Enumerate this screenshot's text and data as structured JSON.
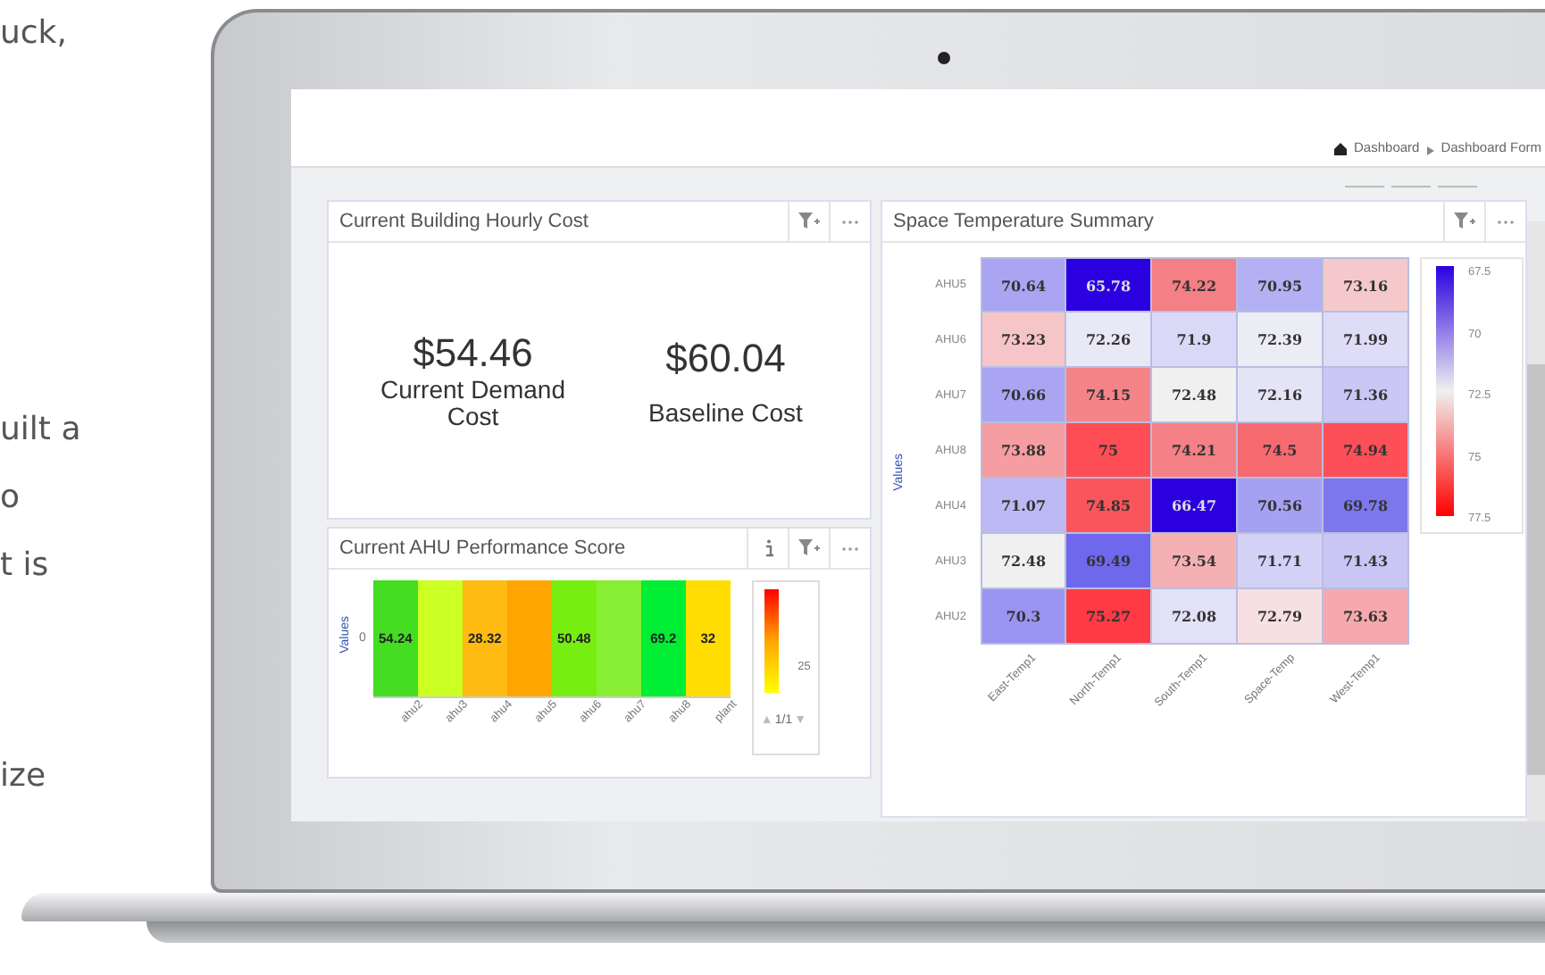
{
  "intro_text": [
    "uck,",
    "uilt a",
    "o",
    "t is",
    "ize"
  ],
  "breadcrumb": [
    "Dashboard",
    "Dashboard Form"
  ],
  "cost_panel": {
    "title": "Current Building Hourly Cost",
    "kpis": [
      {
        "value": "$54.46",
        "label": "Current Demand Cost"
      },
      {
        "value": "$60.04",
        "label": "Baseline Cost"
      }
    ]
  },
  "performance_panel": {
    "title": "Current AHU Performance Score",
    "y_axis_label": "Values",
    "y_tick": "0",
    "cells": [
      {
        "label": "ahu2",
        "value": "54.24",
        "color": "#44dd22"
      },
      {
        "label": "ahu3",
        "color": "#ccff22"
      },
      {
        "label": "ahu4",
        "value": "28.32",
        "color": "#ffbb11"
      },
      {
        "label": "ahu5",
        "color": "#ffa500"
      },
      {
        "label": "ahu6",
        "value": "50.48",
        "color": "#77ee11"
      },
      {
        "label": "ahu7",
        "color": "#88ee33"
      },
      {
        "label": "ahu8",
        "value": "69.2",
        "color": "#00ee33"
      },
      {
        "label": "plant",
        "value": "32",
        "color": "#ffdd00"
      }
    ],
    "legend": {
      "tick": "25",
      "pager_up": "▲",
      "page": "1/1",
      "pager_down": "▼"
    }
  },
  "temperature_panel": {
    "title": "Space Temperature Summary",
    "y_axis_label": "Values",
    "x_axis_labels": [
      "East-Temp1",
      "North-Temp1",
      "South-Temp1",
      "Space-Temp",
      "West-Temp1"
    ],
    "rows": [
      {
        "label": "AHU5",
        "cells": [
          {
            "value": "70.64",
            "color": "#a9a5f2"
          },
          {
            "value": "65.78",
            "color": "#2a00e0"
          },
          {
            "value": "74.22",
            "color": "#f47f85"
          },
          {
            "value": "70.95",
            "color": "#b3b0f4"
          },
          {
            "value": "73.16",
            "color": "#f5c9cb"
          }
        ]
      },
      {
        "label": "AHU6",
        "cells": [
          {
            "value": "73.23",
            "color": "#f6c5c8"
          },
          {
            "value": "72.26",
            "color": "#e8e8f7"
          },
          {
            "value": "71.9",
            "color": "#dad8f6"
          },
          {
            "value": "72.39",
            "color": "#ececf5"
          },
          {
            "value": "71.99",
            "color": "#dedcf6"
          }
        ]
      },
      {
        "label": "AHU7",
        "cells": [
          {
            "value": "70.66",
            "color": "#a9a5f2"
          },
          {
            "value": "74.15",
            "color": "#f58489"
          },
          {
            "value": "72.48",
            "color": "#f0f0f0"
          },
          {
            "value": "72.16",
            "color": "#e5e4f7"
          },
          {
            "value": "71.36",
            "color": "#cac7f5"
          }
        ]
      },
      {
        "label": "AHU8",
        "cells": [
          {
            "value": "73.88",
            "color": "#f59da1"
          },
          {
            "value": "75",
            "color": "#ff4d55"
          },
          {
            "value": "74.21",
            "color": "#f58086"
          },
          {
            "value": "74.5",
            "color": "#f76a70"
          },
          {
            "value": "74.94",
            "color": "#fd4f57"
          }
        ]
      },
      {
        "label": "AHU4",
        "cells": [
          {
            "value": "71.07",
            "color": "#bcb9f4"
          },
          {
            "value": "74.85",
            "color": "#fb555c"
          },
          {
            "value": "66.47",
            "color": "#2a00e0"
          },
          {
            "value": "70.56",
            "color": "#a5a1f2"
          },
          {
            "value": "69.78",
            "color": "#7d77ee"
          }
        ]
      },
      {
        "label": "AHU3",
        "cells": [
          {
            "value": "72.48",
            "color": "#f0f0f0"
          },
          {
            "value": "69.49",
            "color": "#6f68ec"
          },
          {
            "value": "73.54",
            "color": "#f5b0b4"
          },
          {
            "value": "71.71",
            "color": "#d3d1f6"
          },
          {
            "value": "71.43",
            "color": "#c9c6f5"
          }
        ]
      },
      {
        "label": "AHU2",
        "cells": [
          {
            "value": "70.3",
            "color": "#9994f1"
          },
          {
            "value": "75.27",
            "color": "#ff3a44"
          },
          {
            "value": "72.08",
            "color": "#e2e1f7"
          },
          {
            "value": "72.79",
            "color": "#f6e0e1"
          },
          {
            "value": "73.63",
            "color": "#f5a9ad"
          }
        ]
      }
    ],
    "legend_ticks": [
      "67.5",
      "70",
      "72.5",
      "75",
      "77.5"
    ]
  }
}
